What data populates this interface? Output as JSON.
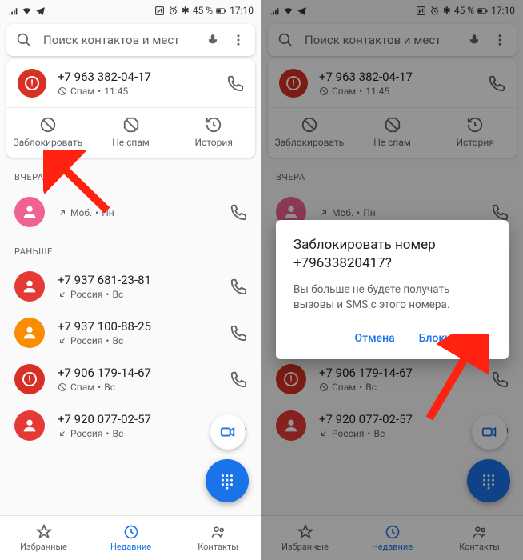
{
  "status": {
    "battery": "45 %",
    "time": "17:10"
  },
  "search": {
    "placeholder": "Поиск контактов и мест"
  },
  "expanded_call": {
    "number": "+7 963 382-04-17",
    "tag": "Спам",
    "time": "11:45"
  },
  "actions": {
    "block": "Заблокировать",
    "notspam": "Не спам",
    "history": "История"
  },
  "sections": {
    "yesterday": "ВЧЕРА",
    "earlier": "РАНЬШЕ"
  },
  "yesterday_row": {
    "sub1": "Моб.",
    "sub2": "Пн"
  },
  "earlier": [
    {
      "avatar": "red",
      "number": "+7 937 681-23-81",
      "sub1": "Россия",
      "sub2": "Вс",
      "dir": "in"
    },
    {
      "avatar": "orange",
      "number": "+7 937 100-88-25",
      "sub1": "Россия",
      "sub2": "Вс",
      "dir": "in"
    },
    {
      "avatar": "spam",
      "number": "+7 906 179-14-67",
      "sub1": "Спам",
      "sub2": "Вс",
      "dir": "none"
    },
    {
      "avatar": "red",
      "number": "+7 920 077-02-57",
      "sub1": "Россия",
      "sub2": "Вс",
      "dir": "in"
    }
  ],
  "nav": {
    "fav": "Избранные",
    "recent": "Недавние",
    "contacts": "Контакты"
  },
  "dialog": {
    "title": "Заблокировать номер +79633820417?",
    "body": "Вы больше не будете получать вызовы и SMS с этого номера.",
    "cancel": "Отмена",
    "ok": "Блокировать"
  }
}
